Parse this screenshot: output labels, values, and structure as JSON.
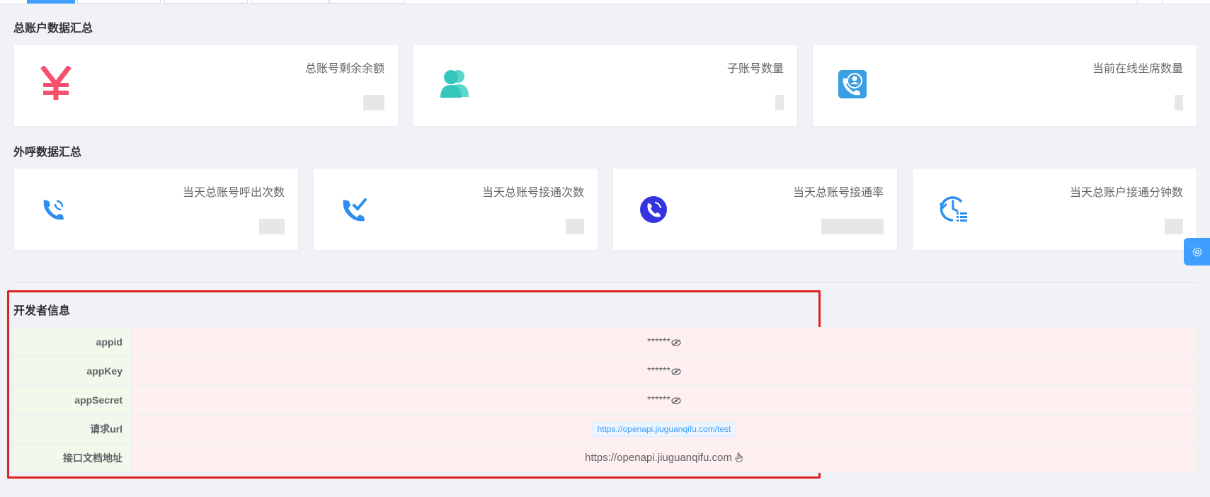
{
  "summary": {
    "title": "总账户数据汇总",
    "cards": [
      {
        "label": "总账号剩余余额",
        "icon": "yen-icon",
        "color": "#f4516c"
      },
      {
        "label": "子账号数量",
        "icon": "users-icon",
        "color": "#36c6bb"
      },
      {
        "label": "当前在线坐席数量",
        "icon": "agent-phone-icon",
        "color": "#3a9ee1"
      }
    ]
  },
  "outbound": {
    "title": "外呼数据汇总",
    "cards": [
      {
        "label": "当天总账号呼出次数",
        "icon": "phone-outgoing-icon",
        "color": "#2d8ef0"
      },
      {
        "label": "当天总账号接通次数",
        "icon": "phone-check-icon",
        "color": "#2d8ef0"
      },
      {
        "label": "当天总账号接通率",
        "icon": "phone-rate-icon",
        "color": "#3535e0"
      },
      {
        "label": "当天总账户接通分钟数",
        "icon": "clock-list-icon",
        "color": "#2d8ef0"
      }
    ]
  },
  "developer": {
    "title": "开发者信息",
    "rows": [
      {
        "key": "appid",
        "value": "******"
      },
      {
        "key": "appKey",
        "value": "******"
      },
      {
        "key": "appSecret",
        "value": "******"
      },
      {
        "key": "请求url",
        "value": "https://openapi.jiuguanqifu.com/test"
      },
      {
        "key": "接口文档地址",
        "value": "https://openapi.jiuguanqifu.com"
      }
    ]
  }
}
